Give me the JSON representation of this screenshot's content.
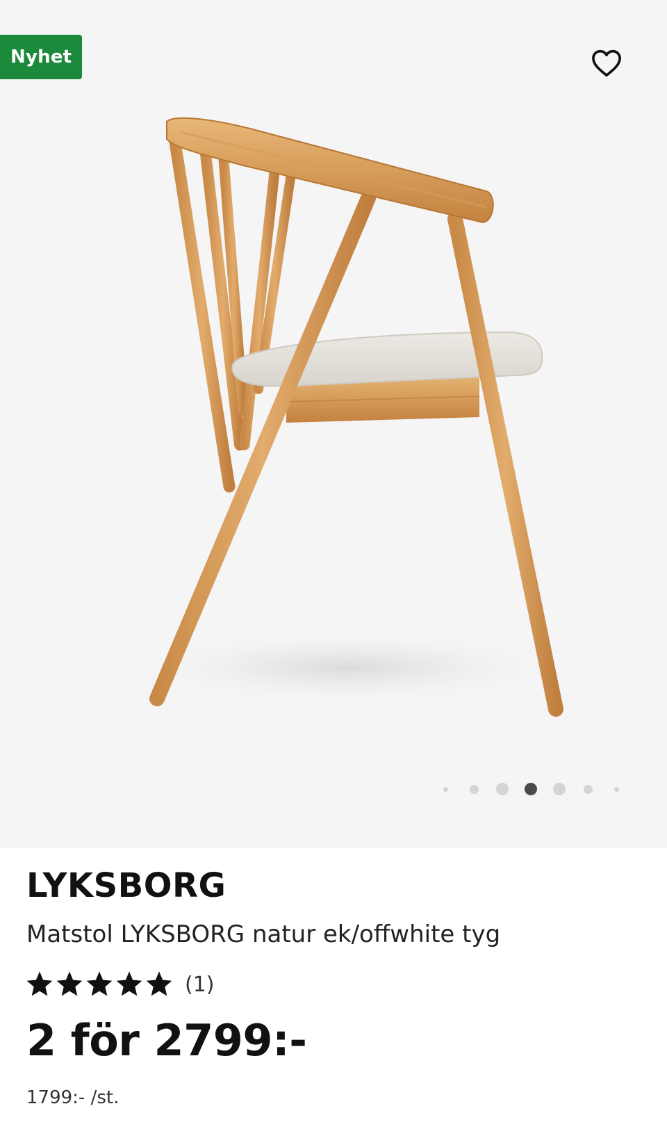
{
  "badge": {
    "label": "Nyhet",
    "color": "#1b8a3a"
  },
  "favorite": {
    "icon": "heart-icon"
  },
  "carousel": {
    "total": 7,
    "active_index": 3
  },
  "product": {
    "brand": "LYKSBORG",
    "description": "Matstol LYKSBORG natur ek/offwhite tyg",
    "rating": {
      "stars": 5,
      "max_stars": 5,
      "count_label": "(1)"
    },
    "price": "2 för 2799:-",
    "unit_price": "1799:- /st."
  }
}
